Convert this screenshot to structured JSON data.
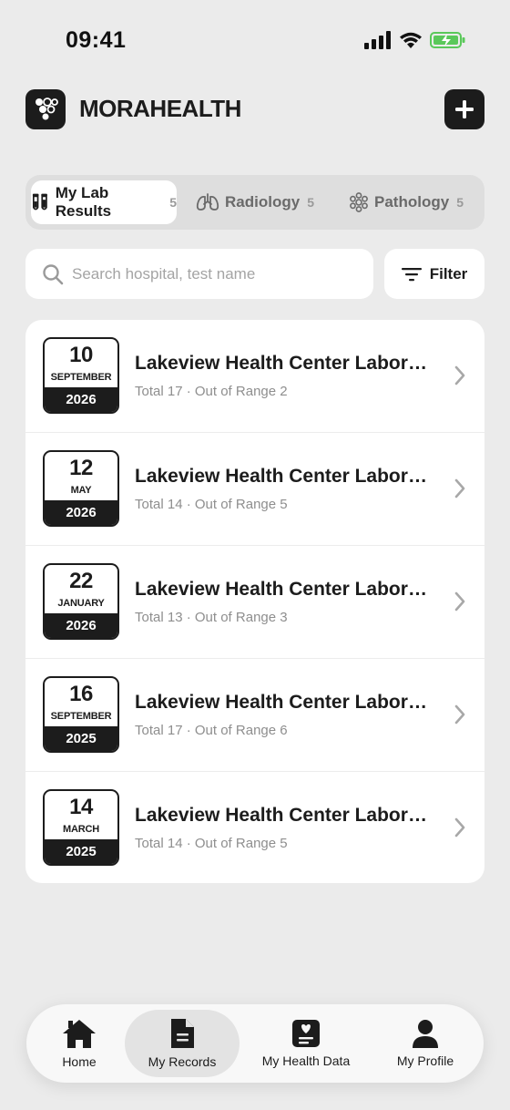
{
  "status_bar": {
    "time": "09:41"
  },
  "header": {
    "brand": "MORAHEALTH"
  },
  "tabs": [
    {
      "label": "My Lab Results",
      "count": "5",
      "icon": "test-tubes-icon",
      "active": true
    },
    {
      "label": "Radiology",
      "count": "5",
      "icon": "lungs-icon",
      "active": false
    },
    {
      "label": "Pathology",
      "count": "5",
      "icon": "cells-icon",
      "active": false
    }
  ],
  "search": {
    "placeholder": "Search hospital, test name",
    "value": ""
  },
  "filter": {
    "label": "Filter"
  },
  "records": [
    {
      "day": "10",
      "month": "SEPTEMBER",
      "year": "2026",
      "title": "Lakeview Health Center Laboratory",
      "summary": "Total 17 · Out of Range 2"
    },
    {
      "day": "12",
      "month": "MAY",
      "year": "2026",
      "title": "Lakeview Health Center Laboratory",
      "summary": "Total 14 · Out of Range 5"
    },
    {
      "day": "22",
      "month": "JANUARY",
      "year": "2026",
      "title": "Lakeview Health Center Laboratory",
      "summary": "Total 13 · Out of Range 3"
    },
    {
      "day": "16",
      "month": "SEPTEMBER",
      "year": "2025",
      "title": "Lakeview Health Center Laboratory",
      "summary": "Total 17 · Out of Range 6"
    },
    {
      "day": "14",
      "month": "MARCH",
      "year": "2025",
      "title": "Lakeview Health Center Laboratory",
      "summary": "Total 14 · Out of Range 5"
    }
  ],
  "bottom_nav": [
    {
      "label": "Home",
      "icon": "home-icon",
      "active": false
    },
    {
      "label": "My Records",
      "icon": "document-icon",
      "active": true
    },
    {
      "label": "My Health Data",
      "icon": "health-data-icon",
      "active": false
    },
    {
      "label": "My Profile",
      "icon": "person-icon",
      "active": false
    }
  ],
  "colors": {
    "background": "#ebebeb",
    "primary": "#1c1c1c",
    "card": "#ffffff",
    "muted": "#8e8e8e",
    "battery": "#5ac85a"
  }
}
